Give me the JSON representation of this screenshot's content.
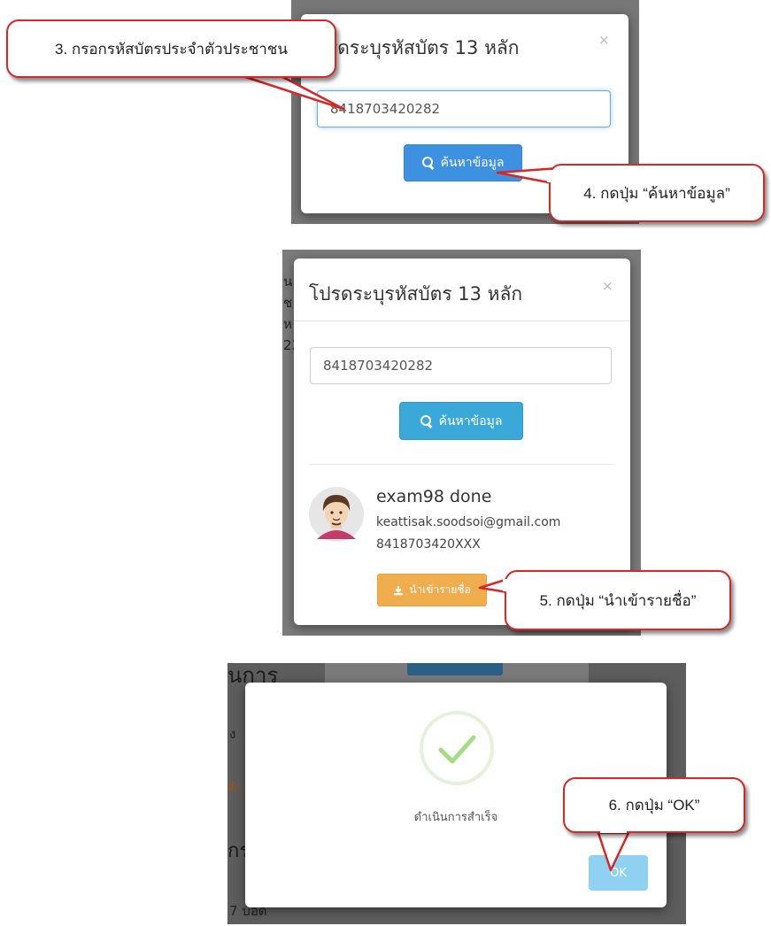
{
  "panel1": {
    "modal_title": "โปรดระบุรหัสบัตร 13 หลัก",
    "modal_title_visible": "รดระบุรหัสบัตร 13 หลัก",
    "close_glyph": "×",
    "id_input_value": "8418703420282",
    "search_button_label": "ค้นหาข้อมูล",
    "callout_step3": "3. กรอกรหัสบัตรประจำตัวประชาชน",
    "callout_step4": "4. กดปุ่ม “ค้นหาข้อมูล”"
  },
  "panel2": {
    "modal_title": "โปรดระบุรหัสบัตร 13 หลัก",
    "close_glyph": "×",
    "id_input_value": "8418703420282",
    "search_button_label": "ค้นหาข้อมูล",
    "bg_fragments": [
      "น",
      "ช",
      "ห",
      "23"
    ],
    "user": {
      "name": "exam98 done",
      "email": "keattisak.soodsoi@gmail.com",
      "id_masked": "8418703420XXX"
    },
    "import_button_label": "นำเข้ารายชื่อ",
    "callout_step5": "5. กดปุ่ม “นำเข้ารายชื่อ”"
  },
  "panel3": {
    "bg_heading": "นการ",
    "bg_fragments": [
      "ง",
      "ดำ",
      "กร",
      "7 บอด"
    ],
    "success_message": "ดำเนินการสำเร็จ",
    "ok_button_label": "OK",
    "callout_step6": "6. กดปุ่ม “OK”"
  },
  "colors": {
    "callout_border": "#d92626",
    "search_button": "#3aa9d9",
    "import_button": "#f0ad4e",
    "ok_button": "#8fd1f0",
    "success_check": "#a5dc86"
  },
  "icons": [
    "search-icon",
    "download-icon",
    "check-icon",
    "close-icon",
    "avatar"
  ]
}
